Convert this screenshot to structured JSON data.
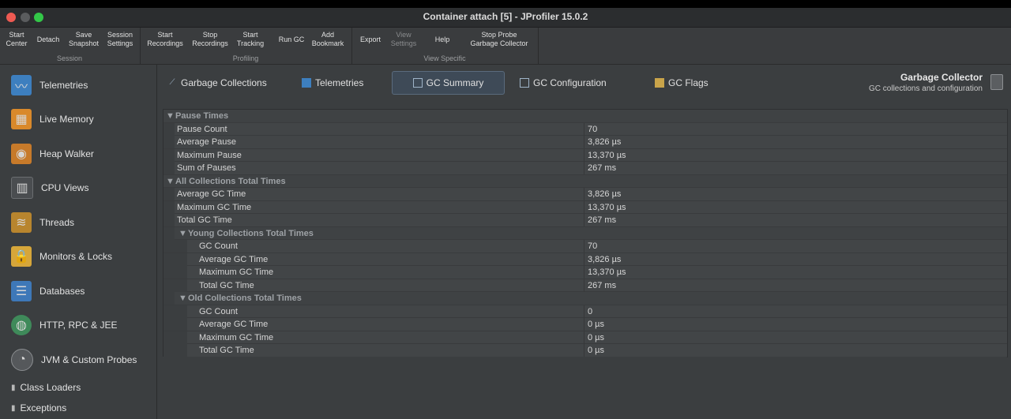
{
  "window": {
    "title": "Container attach [5] - JProfiler 15.0.2"
  },
  "toolbar": {
    "session": {
      "caption": "Session",
      "buttons": [
        "Start\nCenter",
        "Detach",
        "Save\nSnapshot",
        "Session\nSettings"
      ]
    },
    "profiling": {
      "caption": "Profiling",
      "buttons": [
        "Start\nRecordings",
        "Stop\nRecordings",
        "Start\nTracking",
        "Run GC",
        "Add\nBookmark"
      ]
    },
    "view_specific": {
      "caption": "View Specific",
      "buttons": [
        "Export",
        "View\nSettings",
        "Help",
        "Stop Probe\nGarbage Collector"
      ]
    }
  },
  "sidebar": {
    "items": [
      {
        "label": "Telemetries",
        "icon": "telemetries-icon"
      },
      {
        "label": "Live Memory",
        "icon": "live-memory-icon"
      },
      {
        "label": "Heap Walker",
        "icon": "heap-walker-icon"
      },
      {
        "label": "CPU Views",
        "icon": "cpu-views-icon"
      },
      {
        "label": "Threads",
        "icon": "threads-icon"
      },
      {
        "label": "Monitors & Locks",
        "icon": "lock-icon"
      },
      {
        "label": "Databases",
        "icon": "database-icon"
      },
      {
        "label": "HTTP, RPC & JEE",
        "icon": "globe-icon"
      },
      {
        "label": "JVM & Custom Probes",
        "icon": "gauge-icon"
      }
    ],
    "small_items": [
      "Class Loaders",
      "Exceptions"
    ]
  },
  "tabs": [
    {
      "label": "Garbage Collections",
      "selected": false
    },
    {
      "label": "Telemetries",
      "selected": false
    },
    {
      "label": "GC Summary",
      "selected": true
    },
    {
      "label": "GC Configuration",
      "selected": false
    },
    {
      "label": "GC Flags",
      "selected": false
    }
  ],
  "header": {
    "title": "Garbage Collector",
    "subtitle": "GC collections and configuration"
  },
  "summary": {
    "pause_times": {
      "label": "Pause Times",
      "rows": [
        {
          "k": "Pause Count",
          "v": "70"
        },
        {
          "k": "Average Pause",
          "v": "3,826 µs"
        },
        {
          "k": "Maximum Pause",
          "v": "13,370 µs"
        },
        {
          "k": "Sum of Pauses",
          "v": "267 ms"
        }
      ]
    },
    "all_collections": {
      "label": "All Collections Total Times",
      "rows": [
        {
          "k": "Average GC Time",
          "v": "3,826 µs"
        },
        {
          "k": "Maximum GC Time",
          "v": "13,370 µs"
        },
        {
          "k": "Total GC Time",
          "v": "267 ms"
        }
      ]
    },
    "young_collections": {
      "label": "Young Collections Total Times",
      "rows": [
        {
          "k": "GC Count",
          "v": "70"
        },
        {
          "k": "Average GC Time",
          "v": "3,826 µs"
        },
        {
          "k": "Maximum GC Time",
          "v": "13,370 µs"
        },
        {
          "k": "Total GC Time",
          "v": "267 ms"
        }
      ]
    },
    "old_collections": {
      "label": "Old Collections Total Times",
      "rows": [
        {
          "k": "GC Count",
          "v": "0"
        },
        {
          "k": "Average GC Time",
          "v": "0 µs"
        },
        {
          "k": "Maximum GC Time",
          "v": "0 µs"
        },
        {
          "k": "Total GC Time",
          "v": "0 µs"
        }
      ]
    }
  }
}
